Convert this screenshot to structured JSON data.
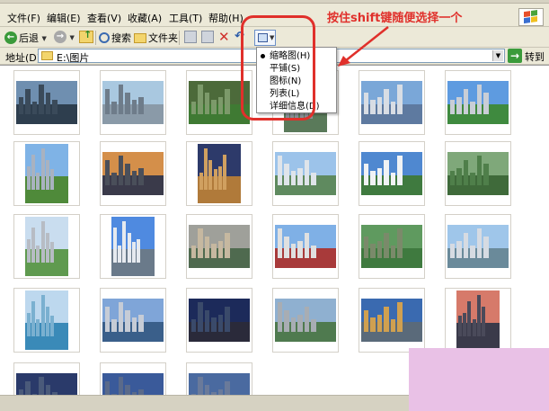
{
  "menu": {
    "items": [
      "文件(F)",
      "编辑(E)",
      "查看(V)",
      "收藏(A)",
      "工具(T)",
      "帮助(H)"
    ]
  },
  "toolbar": {
    "back_label": "后退",
    "search_label": "搜索",
    "folders_label": "文件夹"
  },
  "address": {
    "label": "地址(D)",
    "value": "E:\\图片",
    "go_label": "转到"
  },
  "view_menu": {
    "items": [
      {
        "label": "缩略图(H)",
        "selected": true
      },
      {
        "label": "平铺(S)",
        "selected": false
      },
      {
        "label": "图标(N)",
        "selected": false
      },
      {
        "label": "列表(L)",
        "selected": false
      },
      {
        "label": "详细信息(D)",
        "selected": false
      }
    ]
  },
  "annotation": {
    "text": "按住shift键随便选择一个",
    "color": "#e0302b"
  },
  "thumbnails": [
    {
      "sky": "#6f8fb0",
      "ground": "#2e3e4e",
      "city": "#3a4a5a"
    },
    {
      "sky": "#a9c8e0",
      "ground": "#8a9aa8",
      "city": "#6e7c8a"
    },
    {
      "sky": "#4c6a3a",
      "ground": "#3f7a33",
      "city": "#7c9a6a"
    },
    {
      "sky": "#9fc0de",
      "ground": "#5a7a5a",
      "city": "#8a8f98"
    },
    {
      "sky": "#7aa7d8",
      "ground": "#5e7aa0",
      "city": "#d8dde4"
    },
    {
      "sky": "#5e9be0",
      "ground": "#3f8a3f",
      "city": "#c9ced6"
    },
    {
      "sky": "#7fb3e6",
      "ground": "#4f8a3a",
      "city": "#a9b2c0"
    },
    {
      "sky": "#d48f4a",
      "ground": "#3a3a4a",
      "city": "#4a4f5a"
    },
    {
      "sky": "#2d3a6a",
      "ground": "#b07a3a",
      "city": "#d0a060"
    },
    {
      "sky": "#9cc3ea",
      "ground": "#5f8a5f",
      "city": "#dfe4ea"
    },
    {
      "sky": "#4f88d0",
      "ground": "#3f7a3f",
      "city": "#f0f2f4"
    },
    {
      "sky": "#7fa87a",
      "ground": "#3f6a3a",
      "city": "#4f7f4a"
    },
    {
      "sky": "#c9ddef",
      "ground": "#5f9a4f",
      "city": "#b7bcc4"
    },
    {
      "sky": "#4f8ae0",
      "ground": "#6a7a8a",
      "city": "#e6eaef"
    },
    {
      "sky": "#9fa09a",
      "ground": "#4f6a4f",
      "city": "#c6b8a0"
    },
    {
      "sky": "#7fb0e6",
      "ground": "#a83a3a",
      "city": "#e0e0e0"
    },
    {
      "sky": "#5f9a5f",
      "ground": "#3f7a3f",
      "city": "#7a8a6a"
    },
    {
      "sky": "#9fc6ea",
      "ground": "#6a8a9a",
      "city": "#d6dbe2"
    },
    {
      "sky": "#bdd8ee",
      "ground": "#3a8ab8",
      "city": "#7ab0d0"
    },
    {
      "sky": "#7fa5d8",
      "ground": "#3a5f8a",
      "city": "#c6ccd6"
    },
    {
      "sky": "#1c2a5a",
      "ground": "#2a2a3a",
      "city": "#3a4a6a"
    },
    {
      "sky": "#8fb0d0",
      "ground": "#4f7a4f",
      "city": "#a8adb3"
    },
    {
      "sky": "#3a6ab0",
      "ground": "#5a6a7a",
      "city": "#d0a050"
    },
    {
      "sky": "#d67a6a",
      "ground": "#3a3a4a",
      "city": "#4a4a5a"
    },
    {
      "sky": "#2a3a6a",
      "ground": "#1f2f4f",
      "city": "#4a5a7a"
    },
    {
      "sky": "#3a5a9a",
      "ground": "#1f2f4f",
      "city": "#5a6a8a"
    },
    {
      "sky": "#4a6aa0",
      "ground": "#2a3a5a",
      "city": "#6a7a9a"
    }
  ]
}
